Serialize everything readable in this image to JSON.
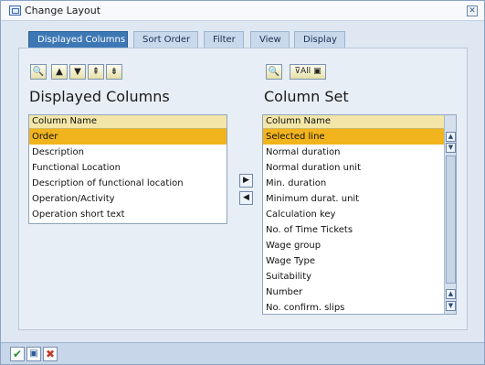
{
  "window": {
    "title": "Change Layout"
  },
  "tabs": [
    {
      "label": "Displayed Columns"
    },
    {
      "label": "Sort Order"
    },
    {
      "label": "Filter"
    },
    {
      "label": "View"
    },
    {
      "label": "Display"
    }
  ],
  "left": {
    "heading": "Displayed Columns",
    "column_header": "Column Name",
    "rows": [
      "Order",
      "Description",
      "Functional Location",
      "Description of functional location",
      "Operation/Activity",
      "Operation short text"
    ],
    "toolbar": [
      "find-icon",
      "move-up-icon",
      "move-down-icon",
      "move-top-icon",
      "move-bottom-icon"
    ]
  },
  "right": {
    "heading": "Column Set",
    "column_header": "Column Name",
    "filter_label": "All",
    "rows": [
      "Selected line",
      "Normal duration",
      "Normal duration unit",
      "Min. duration",
      "Minimum durat. unit",
      "Calculation key",
      "No. of Time Tickets",
      "Wage group",
      "Wage Type",
      "Suitability",
      "Number",
      "No. confirm. slips"
    ]
  },
  "colors": {
    "active_tab": "#3d78b5",
    "selected_row": "#f2b41c",
    "list_header": "#f3e6a8",
    "ok": "#2e8b2e",
    "cancel": "#c0392b"
  }
}
